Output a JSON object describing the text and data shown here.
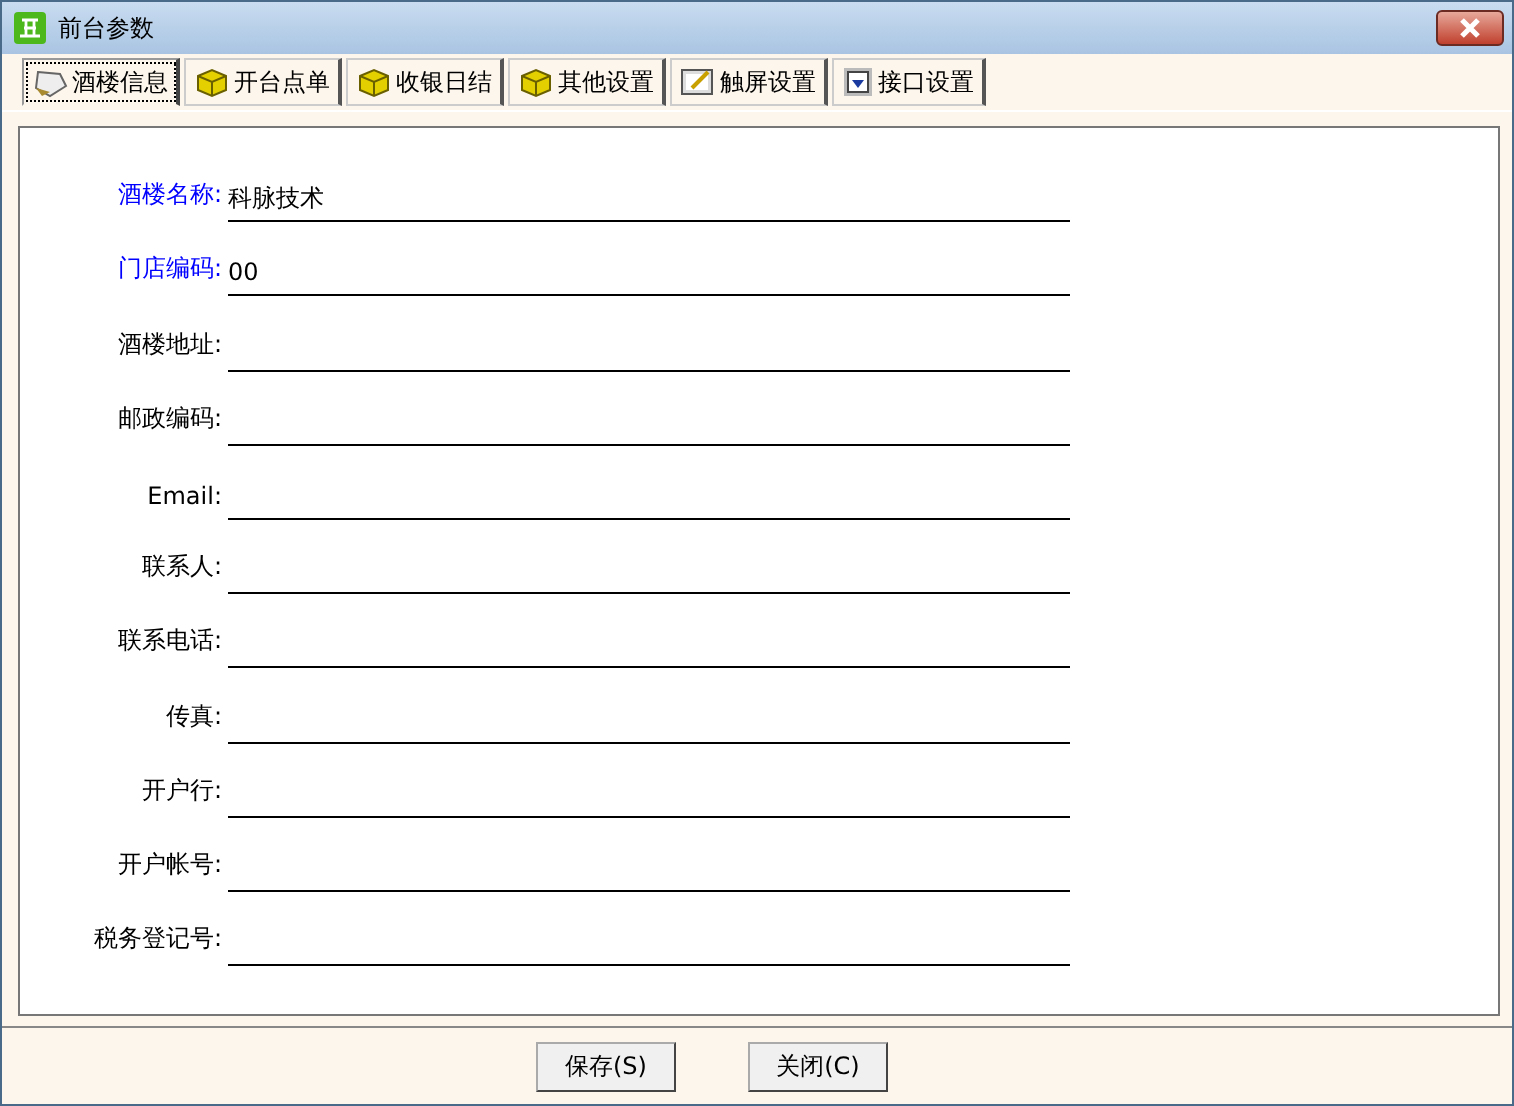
{
  "window": {
    "title": "前台参数"
  },
  "tabs": [
    {
      "label": "酒楼信息",
      "kind": "note",
      "selected": true
    },
    {
      "label": "开台点单",
      "kind": "box",
      "selected": false
    },
    {
      "label": "收银日结",
      "kind": "box",
      "selected": false
    },
    {
      "label": "其他设置",
      "kind": "box",
      "selected": false
    },
    {
      "label": "触屏设置",
      "kind": "pen",
      "selected": false
    },
    {
      "label": "接口设置",
      "kind": "download",
      "selected": false
    }
  ],
  "fields": [
    {
      "label": "酒楼名称:",
      "value": "科脉技术",
      "required": true
    },
    {
      "label": "门店编码:",
      "value": "00",
      "required": true
    },
    {
      "label": "酒楼地址:",
      "required": false
    },
    {
      "label": "邮政编码:",
      "required": false
    },
    {
      "label": "Email:",
      "required": false
    },
    {
      "label": "联系人:",
      "required": false
    },
    {
      "label": "联系电话:",
      "required": false
    },
    {
      "label": "传真:",
      "required": false
    },
    {
      "label": "开户行:",
      "required": false
    },
    {
      "label": "开户帐号:",
      "required": false
    },
    {
      "label": "税务登记号:",
      "required": false
    }
  ],
  "buttons": [
    "保存(S)",
    "关闭(C)"
  ]
}
